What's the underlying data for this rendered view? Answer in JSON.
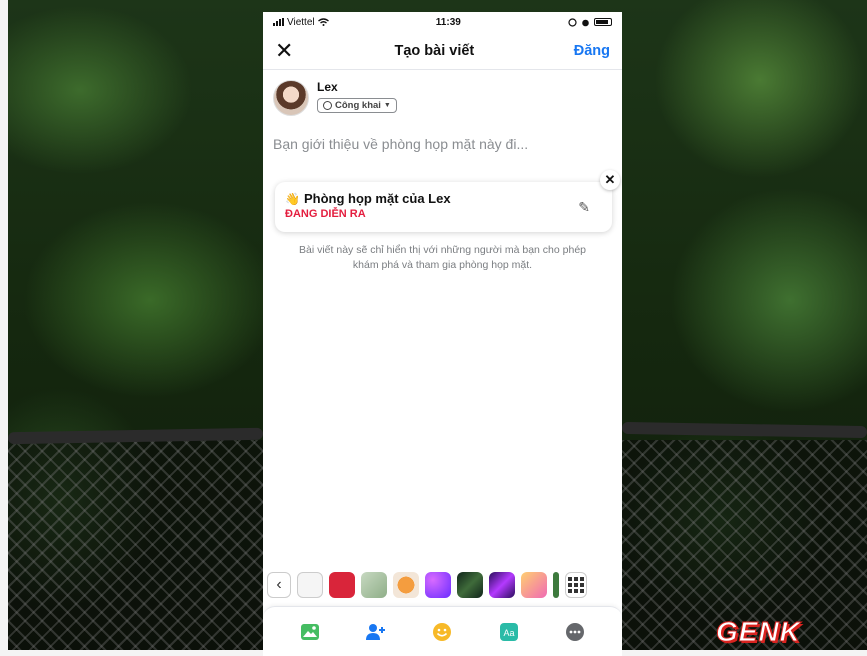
{
  "status_bar": {
    "carrier": "Viettel",
    "time": "11:39"
  },
  "header": {
    "close_icon": "close-icon",
    "title": "Tạo bài viết",
    "post_label": "Đăng"
  },
  "author": {
    "name": "Lex",
    "privacy_label": "Công khai"
  },
  "composer": {
    "placeholder": "Bạn giới thiệu về phòng họp mặt này đi..."
  },
  "room_card": {
    "icon": "waving-hand-icon",
    "title": "Phòng họp mặt của Lex",
    "status": "ĐANG DIỄN RA"
  },
  "notice": "Bài viết này sẽ chỉ hiển thị với những người mà bạn cho phép khám phá và tham gia phòng họp mặt.",
  "background_swatches": [
    {
      "name": "white",
      "color": "#f5f5f5"
    },
    {
      "name": "red",
      "color": "#d9253a"
    },
    {
      "name": "illustration-green",
      "color": "#a9c4a3"
    },
    {
      "name": "orange-fruit",
      "color": "#f3a35b"
    },
    {
      "name": "purple-gradient",
      "color": "#8e44ff"
    },
    {
      "name": "dark-leaf",
      "color": "#1f3b2a"
    },
    {
      "name": "violet-gradient",
      "color": "#6b2fbf"
    },
    {
      "name": "pink-orange",
      "color": "#f6a1a8"
    },
    {
      "name": "green-edge",
      "color": "#3d7a3d"
    }
  ],
  "toolbar_icons": [
    "photo-icon",
    "tag-people-icon",
    "feeling-icon",
    "text-style-icon",
    "more-icon"
  ],
  "accent_color": "#1877f2",
  "live_color": "#e41e3f",
  "watermark": "GENK"
}
